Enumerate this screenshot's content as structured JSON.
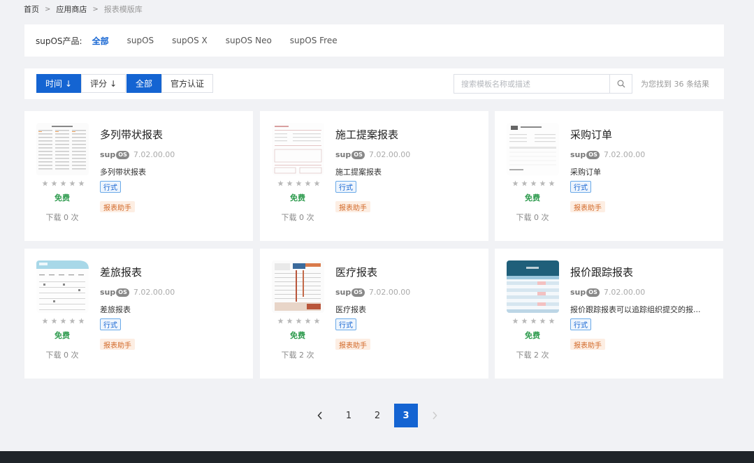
{
  "breadcrumb": {
    "home": "首页",
    "store": "应用商店",
    "current": "报表模版库"
  },
  "product_filter": {
    "label": "supOS产品:",
    "options": [
      "全部",
      "supOS",
      "supOS X",
      "supOS Neo",
      "supOS Free"
    ],
    "active": "全部"
  },
  "toolbar": {
    "sort_time": "时间",
    "sort_rating": "评分",
    "scope_all": "全部",
    "scope_official": "官方认证",
    "search_placeholder": "搜索模板名称或描述",
    "result_text": "为您找到 36 条结果"
  },
  "cards": [
    {
      "title": "多列带状报表",
      "version": "7.02.00.00",
      "desc": "多列带状报表",
      "tag": "行式",
      "helper": "报表助手",
      "price": "免费",
      "downloads": "下载 0 次",
      "rating": 0
    },
    {
      "title": "施工提案报表",
      "version": "7.02.00.00",
      "desc": "施工提案报表",
      "tag": "行式",
      "helper": "报表助手",
      "price": "免费",
      "downloads": "下载 0 次",
      "rating": 0
    },
    {
      "title": "采购订单",
      "version": "7.02.00.00",
      "desc": "采购订单",
      "tag": "行式",
      "helper": "报表助手",
      "price": "免费",
      "downloads": "下载 0 次",
      "rating": 0
    },
    {
      "title": "差旅报表",
      "version": "7.02.00.00",
      "desc": "差旅报表",
      "tag": "行式",
      "helper": "报表助手",
      "price": "免费",
      "downloads": "下载 0 次",
      "rating": 0
    },
    {
      "title": "医疗报表",
      "version": "7.02.00.00",
      "desc": "医疗报表",
      "tag": "行式",
      "helper": "报表助手",
      "price": "免费",
      "downloads": "下载 2 次",
      "rating": 0
    },
    {
      "title": "报价跟踪报表",
      "version": "7.02.00.00",
      "desc": "报价跟踪报表可以追踪组织提交的报...",
      "tag": "行式",
      "helper": "报表助手",
      "price": "免费",
      "downloads": "下载 2 次",
      "rating": 0
    }
  ],
  "logo_text": {
    "sup": "sup",
    "os": "OS"
  },
  "pagination": {
    "pages": [
      "1",
      "2",
      "3"
    ],
    "current": "3"
  },
  "colors": {
    "primary": "#1464d2",
    "free": "#2e9b4e",
    "helper_tag": "#d26a2a",
    "star": "#b8b8b8"
  }
}
